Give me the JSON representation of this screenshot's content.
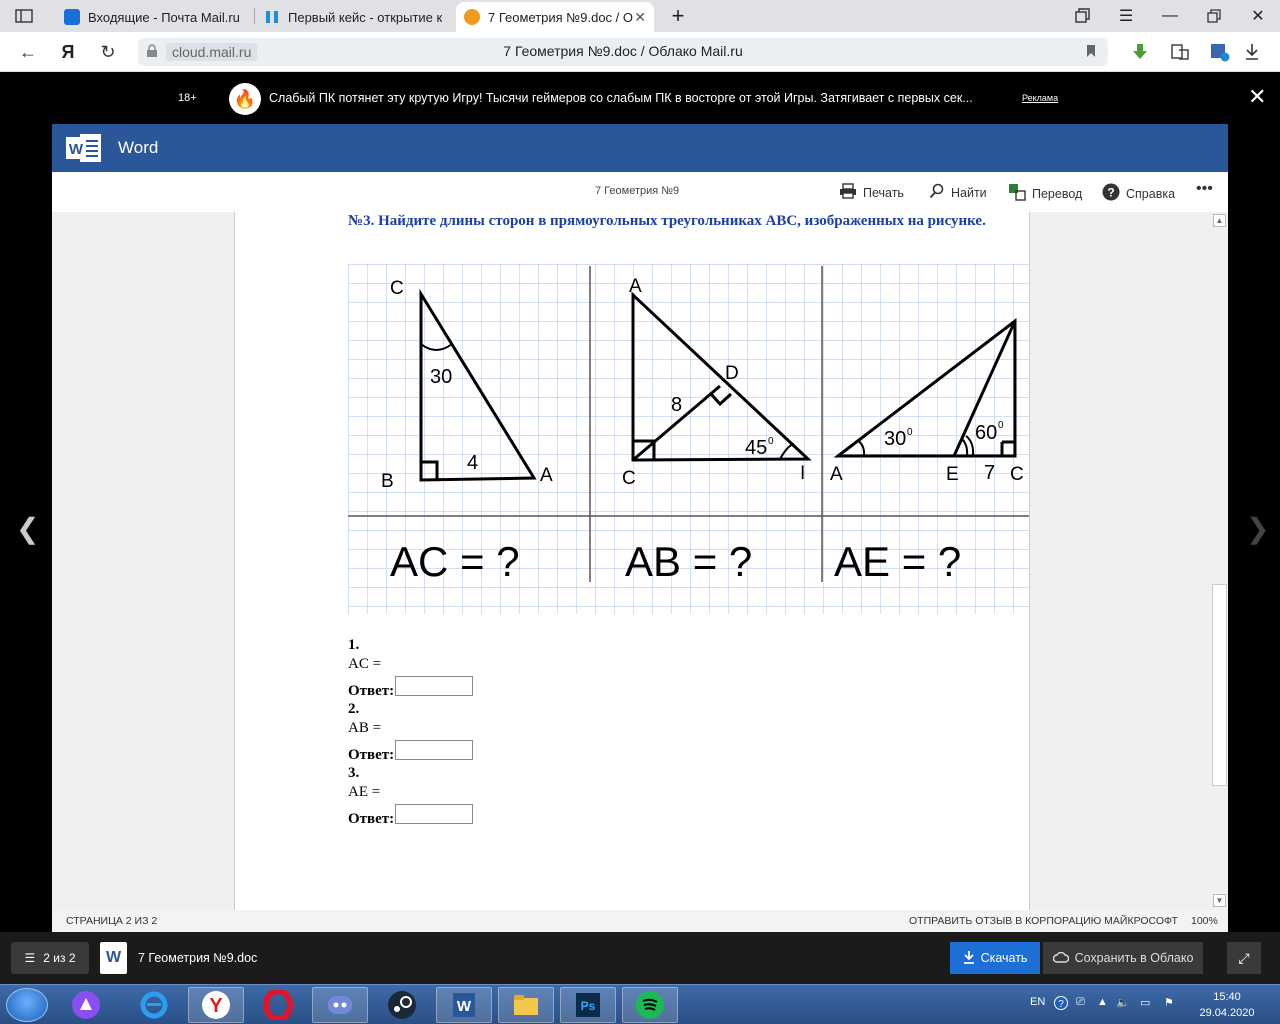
{
  "browser": {
    "tabs": [
      {
        "title": "Входящие - Почта Mail.ru",
        "color": "#1a6fd6"
      },
      {
        "title": "Первый кейс - открытие к",
        "color": "#1e8fd6"
      },
      {
        "title": "7 Геометрия №9.doc / О",
        "color": "#f29a1f"
      }
    ],
    "new_tab": "+",
    "url_host": "cloud.mail.ru",
    "page_title": "7 Геометрия №9.doc / Облако Mail.ru"
  },
  "ad": {
    "age": "18+",
    "text": "Слабый ПК потянет эту крутую Игру!   Тысячи геймеров со слабым ПК в восторге от этой Игры. Затягивает с первых сек...",
    "label": "Реклама"
  },
  "word": {
    "app_name": "Word",
    "doc_title": "7 Геометрия №9",
    "toolbar": {
      "print": "Печать",
      "find": "Найти",
      "translate": "Перевод",
      "help": "Справка"
    },
    "accent": "#2b579a"
  },
  "document": {
    "task_title": "№3. Найдите длины сторон в прямоугольных треугольниках ABC, изображенных на рисунке.",
    "figure": {
      "fig1": {
        "C": "C",
        "B": "B",
        "A": "A",
        "angle": "30",
        "side": "4",
        "question": "AC = ?"
      },
      "fig2": {
        "A": "A",
        "D": "D",
        "C": "C",
        "I": "I",
        "side": "8",
        "angle": "45",
        "deg": "0",
        "question": "AB = ?"
      },
      "fig3": {
        "A": "A",
        "E": "E",
        "C": "C",
        "side": "7",
        "angle1": "30",
        "angle2": "60",
        "deg": "0",
        "question": "AE = ?"
      }
    },
    "answers": [
      {
        "num": "1.",
        "expr": "AC =",
        "label": "Ответ:"
      },
      {
        "num": "2.",
        "expr": "AB =",
        "label": "Ответ:"
      },
      {
        "num": "3.",
        "expr": "AE =",
        "label": "Ответ:"
      }
    ]
  },
  "status": {
    "page": "СТРАНИЦА 2 ИЗ 2",
    "feedback": "ОТПРАВИТЬ ОТЗЫВ В КОРПОРАЦИЮ МАЙКРОСОФТ",
    "zoom": "100%"
  },
  "viewer": {
    "pages": "2 из 2",
    "doc_name": "7 Геометрия №9.doc",
    "download": "Скачать",
    "save": "Сохранить в Облако"
  },
  "taskbar": {
    "lang": "EN",
    "time": "15:40",
    "date": "29.04.2020"
  }
}
